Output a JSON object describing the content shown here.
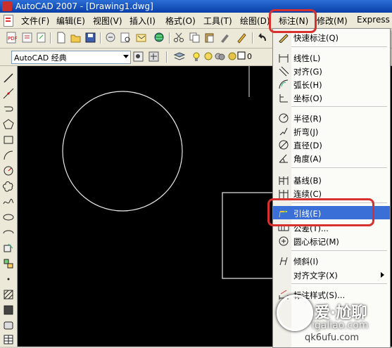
{
  "window": {
    "title": "AutoCAD 2007 - [Drawing1.dwg]"
  },
  "menubar": {
    "items": [
      "文件(F)",
      "编辑(E)",
      "视图(V)",
      "插入(I)",
      "格式(O)",
      "工具(T)",
      "绘图(D)",
      "标注(N)",
      "修改(M)",
      "Express"
    ],
    "active": "标注(N)"
  },
  "workspace": {
    "value": "AutoCAD 经典"
  },
  "layer": {
    "value": "0"
  },
  "dimension_menu": {
    "items": [
      {
        "label": "快速标注(Q)",
        "icon": "quick-dimension-icon"
      },
      {
        "label": "线性(L)",
        "icon": "linear-dimension-icon"
      },
      {
        "label": "对齐(G)",
        "icon": "aligned-dimension-icon"
      },
      {
        "label": "弧长(H)",
        "icon": "arc-length-icon"
      },
      {
        "label": "坐标(O)",
        "icon": "ordinate-icon"
      },
      {
        "label": "半径(R)",
        "icon": "radius-icon"
      },
      {
        "label": "折弯(J)",
        "icon": "jogged-icon"
      },
      {
        "label": "直径(D)",
        "icon": "diameter-icon"
      },
      {
        "label": "角度(A)",
        "icon": "angular-icon"
      },
      {
        "label": "基线(B)",
        "icon": "baseline-icon"
      },
      {
        "label": "连续(C)",
        "icon": "continue-icon"
      },
      {
        "label": "引线(E)",
        "icon": "leader-icon",
        "highlighted": true
      },
      {
        "label": "公差(T)...",
        "icon": "tolerance-icon"
      },
      {
        "label": "圆心标记(M)",
        "icon": "center-mark-icon"
      },
      {
        "label": "倾斜(I)",
        "icon": "oblique-icon"
      },
      {
        "label": "对齐文字(X)",
        "icon": "",
        "submenu": true
      },
      {
        "label": "标注样式(S)...",
        "icon": "dimension-style-icon"
      }
    ]
  },
  "watermark": {
    "line1": "爱·尬聊",
    "line2": "igaliao.com",
    "line3": "qk6ufu.com"
  },
  "colors": {
    "highlight_box": "#d8302c",
    "menu_hover": "#3a6fd8"
  }
}
